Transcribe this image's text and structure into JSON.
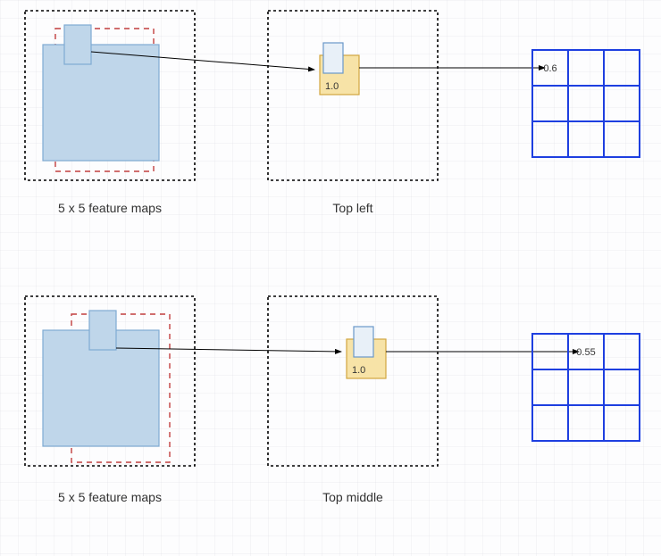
{
  "labels": {
    "source_row1": "5 x 5 feature maps",
    "source_row2": "5 x 5 feature maps",
    "mid_row1": "Top left",
    "mid_row2": "Top middle",
    "match_score_row1": "1.0",
    "match_score_row2": "1.0",
    "grid_val_row1": "0.6",
    "grid_val_row2": "0.55"
  },
  "chart_data": {
    "type": "table",
    "description": "Two-step sliding-window correlation illustration",
    "steps": [
      {
        "step_label": "Top left",
        "feature_map_size": "5x5",
        "filter_match_value": 1.0,
        "output_grid": {
          "rows": 3,
          "cols": 3,
          "filled": {
            "row": 0,
            "col": 0,
            "value": 0.6
          }
        }
      },
      {
        "step_label": "Top middle",
        "feature_map_size": "5x5",
        "filter_match_value": 1.0,
        "output_grid": {
          "rows": 3,
          "cols": 3,
          "filled": {
            "row": 0,
            "col": 1,
            "value": 0.55
          }
        }
      }
    ]
  }
}
